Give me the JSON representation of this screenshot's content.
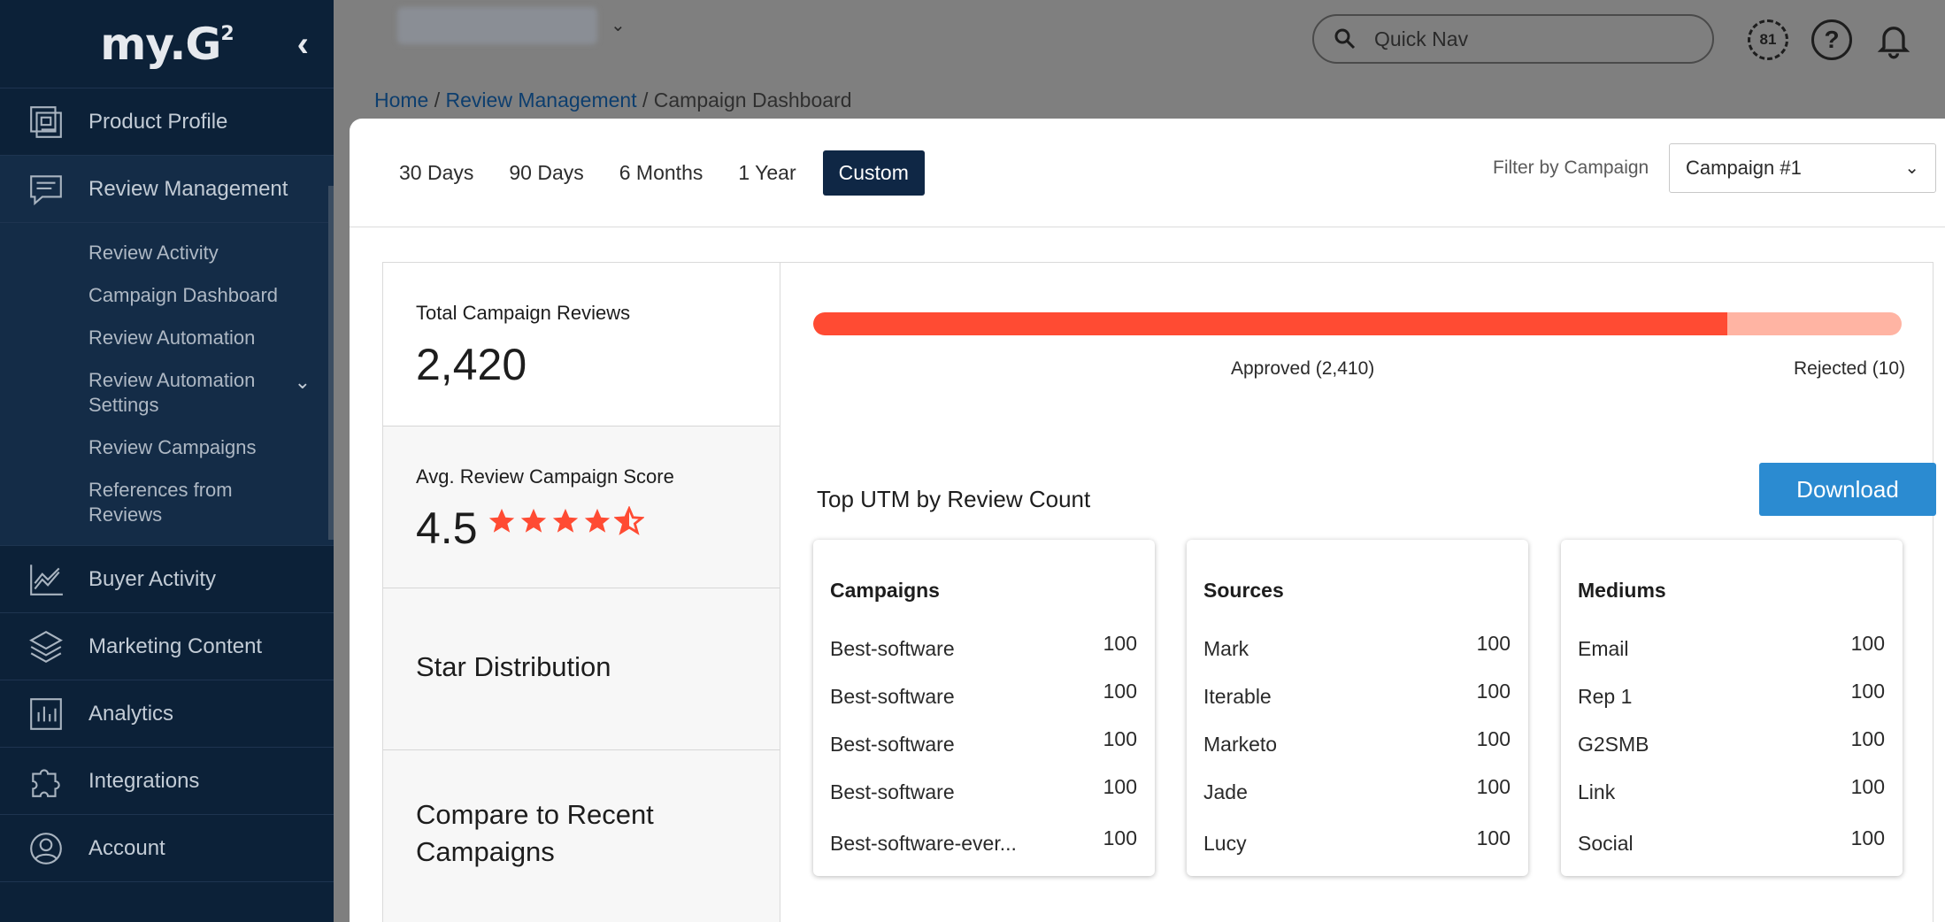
{
  "logo": {
    "text": "my.G",
    "sup": "2"
  },
  "sidebar": {
    "collapse_glyph": "‹",
    "items": [
      {
        "label": "Product Profile",
        "icon": "product-profile-icon"
      },
      {
        "label": "Review Management",
        "icon": "review-management-icon"
      },
      {
        "label": "Buyer Activity",
        "icon": "buyer-activity-icon"
      },
      {
        "label": "Marketing Content",
        "icon": "marketing-content-icon"
      },
      {
        "label": "Analytics",
        "icon": "analytics-icon"
      },
      {
        "label": "Integrations",
        "icon": "integrations-icon"
      },
      {
        "label": "Account",
        "icon": "account-icon"
      }
    ],
    "submenu": [
      {
        "label": "Review Activity"
      },
      {
        "label": "Campaign Dashboard"
      },
      {
        "label": "Review Automation"
      },
      {
        "label": "Review Automation Settings"
      },
      {
        "label": "Review Campaigns"
      },
      {
        "label": "References from Reviews"
      }
    ]
  },
  "topbar": {
    "search_label": "Quick Nav",
    "badge": "81",
    "help": "?"
  },
  "breadcrumb": {
    "home": "Home",
    "sep": " / ",
    "review": "Review Management",
    "current": "Campaign Dashboard"
  },
  "tabs": [
    "30 Days",
    "90 Days",
    "6 Months",
    "1 Year",
    "Custom"
  ],
  "filter": {
    "label": "Filter by Campaign",
    "selected": "Campaign #1"
  },
  "stats": {
    "total_label": "Total Campaign Reviews",
    "total_value": "2,420",
    "avg_label": "Avg. Review Campaign Score",
    "avg_value": "4.5",
    "rating": 4.5,
    "star_distribution": "Star Distribution",
    "compare": "Compare to Recent Campaigns"
  },
  "progress": {
    "approved_label": "Approved (2,410)",
    "rejected_label": "Rejected (10)",
    "approved_fraction": 0.84,
    "colors": {
      "approved": "#ff4b33",
      "rejected": "#ffb4a3"
    }
  },
  "utm": {
    "title": "Top UTM by Review Count",
    "download": "Download",
    "cards": [
      {
        "title": "Campaigns",
        "rows": [
          {
            "name": "Best-software",
            "value": "100"
          },
          {
            "name": "Best-software",
            "value": "100"
          },
          {
            "name": "Best-software",
            "value": "100"
          },
          {
            "name": "Best-software",
            "value": "100"
          },
          {
            "name": "Best-software-ever...",
            "value": "100"
          }
        ]
      },
      {
        "title": "Sources",
        "rows": [
          {
            "name": "Mark",
            "value": "100"
          },
          {
            "name": "Iterable",
            "value": "100"
          },
          {
            "name": "Marketo",
            "value": "100"
          },
          {
            "name": "Jade",
            "value": "100"
          },
          {
            "name": "Lucy",
            "value": "100"
          }
        ]
      },
      {
        "title": "Mediums",
        "rows": [
          {
            "name": "Email",
            "value": "100"
          },
          {
            "name": "Rep 1",
            "value": "100"
          },
          {
            "name": "G2SMB",
            "value": "100"
          },
          {
            "name": "Link",
            "value": "100"
          },
          {
            "name": "Social",
            "value": "100"
          }
        ]
      }
    ]
  }
}
